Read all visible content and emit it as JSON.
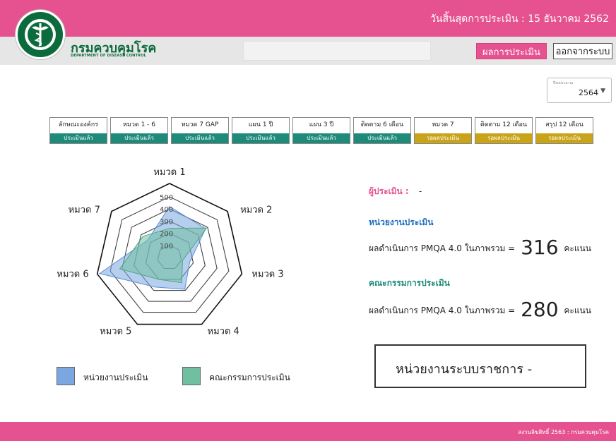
{
  "header": {
    "deadline_text": "วันสิ้นสุดการประเมิน : 15 ธันวาคม 2562",
    "org_name_th": "กรมควบคุมโรค",
    "org_name_en": "DEPARTMENT OF DISEASE CONTROL",
    "result_button": "ผลการประเมิน",
    "logout_button": "ออกจากระบบ"
  },
  "year_select": {
    "caption": "ปีงบประมาณ",
    "value": "2564"
  },
  "tabs": [
    {
      "label": "ลักษณะองค์กร",
      "status": "ประเมินแล้ว",
      "state": "done"
    },
    {
      "label": "หมวด 1 - 6",
      "status": "ประเมินแล้ว",
      "state": "done"
    },
    {
      "label": "หมวด 7 GAP",
      "status": "ประเมินแล้ว",
      "state": "done"
    },
    {
      "label": "แผน 1 ปี",
      "status": "ประเมินแล้ว",
      "state": "done"
    },
    {
      "label": "แผน 3 ปี",
      "status": "ประเมินแล้ว",
      "state": "done"
    },
    {
      "label": "ติดตาม 6 เดือน",
      "status": "ประเมินแล้ว",
      "state": "done"
    },
    {
      "label": "หมวด 7",
      "status": "รอผลประเมิน",
      "state": "wait"
    },
    {
      "label": "ติดตาม 12 เดือน",
      "status": "รอผลประเมิน",
      "state": "wait"
    },
    {
      "label": "สรุป 12 เดือน",
      "status": "รอผลประเมิน",
      "state": "wait"
    }
  ],
  "chart_data": {
    "type": "radar",
    "categories": [
      "หมวด 1",
      "หมวด 2",
      "หมวด 3",
      "หมวด 4",
      "หมวด 5",
      "หมวด 6",
      "หมวด 7"
    ],
    "ticks": [
      "100",
      "200",
      "300",
      "400",
      "500"
    ],
    "rmax": 500,
    "grid": true,
    "legend_position": "bottom",
    "series": [
      {
        "name": "หน่วยงานประเมิน",
        "values": [
          420,
          380,
          170,
          290,
          270,
          590,
          230
        ],
        "color": "#7aa7e0"
      },
      {
        "name": "คณะกรรมการประเมิน",
        "values": [
          240,
          390,
          110,
          230,
          200,
          420,
          280
        ],
        "color": "#6fbfa0"
      }
    ]
  },
  "info": {
    "assessor_label": "ผู้ประเมิน :",
    "assessor_value": "-",
    "unit_heading": "หน่วยงานประเมิน",
    "unit_score_prefix": "ผลดำเนินการ PMQA 4.0 ในภาพรวม =",
    "unit_score": "316",
    "unit_score_suffix": "คะแนน",
    "committee_heading": "คณะกรรมการประเมิน",
    "committee_score_prefix": "ผลดำเนินการ PMQA 4.0 ในภาพรวม =",
    "committee_score": "280",
    "committee_score_suffix": "คะแนน"
  },
  "gov_box_text": "หน่วยงานระบบราชการ  -",
  "footer_text": "สงวนลิขสิทธิ์ 2563 : กรมควบคุมโรค",
  "colors": {
    "brand_pink": "#e5528f",
    "brand_green": "#0c6b3c",
    "status_done": "#1d8a7a",
    "status_wait": "#c9a418"
  }
}
